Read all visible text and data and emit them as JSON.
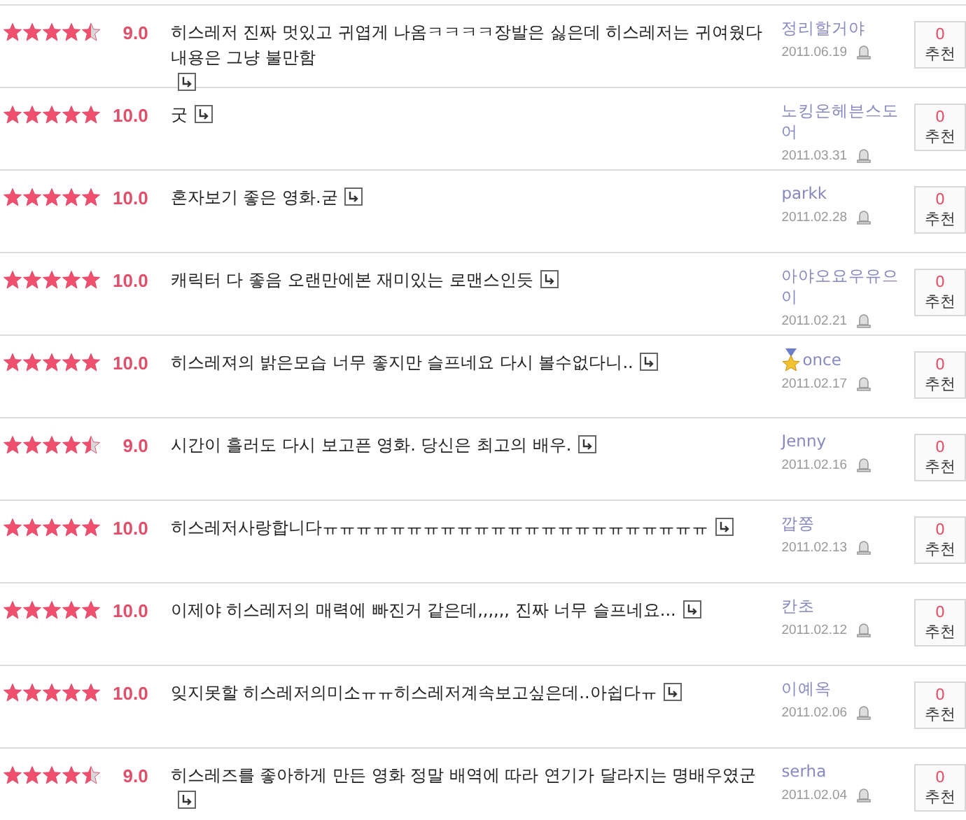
{
  "reviews": [
    {
      "stars": 4.5,
      "score": "9.0",
      "comment": "히스레저 진짜 멋있고 귀엽게 나옴ㅋㅋㅋㅋ장발은 싫은데 히스레저는 귀여웠다 내용은 그냥 불만함",
      "user": "정리할거야",
      "medal": false,
      "date": "2011.06.19",
      "rec_count": "0",
      "rec_label": "추천"
    },
    {
      "stars": 5,
      "score": "10.0",
      "comment": "굿",
      "user": "노킹온헤븐스도어",
      "medal": false,
      "date": "2011.03.31",
      "rec_count": "0",
      "rec_label": "추천"
    },
    {
      "stars": 5,
      "score": "10.0",
      "comment": "혼자보기 좋은 영화.굳",
      "user": "parkk",
      "medal": false,
      "date": "2011.02.28",
      "rec_count": "0",
      "rec_label": "추천"
    },
    {
      "stars": 5,
      "score": "10.0",
      "comment": "캐릭터 다 좋음 오랜만에본 재미있는 로맨스인듯",
      "user": "아야오요우유으이",
      "medal": false,
      "date": "2011.02.21",
      "rec_count": "0",
      "rec_label": "추천"
    },
    {
      "stars": 5,
      "score": "10.0",
      "comment": "히스레져의 밝은모습 너무 좋지만 슬프네요 다시 볼수없다니..",
      "user": "once",
      "medal": true,
      "date": "2011.02.17",
      "rec_count": "0",
      "rec_label": "추천"
    },
    {
      "stars": 4.5,
      "score": "9.0",
      "comment": "시간이 흘러도 다시 보고픈 영화. 당신은 최고의 배우.",
      "user": "Jenny",
      "medal": false,
      "date": "2011.02.16",
      "rec_count": "0",
      "rec_label": "추천"
    },
    {
      "stars": 5,
      "score": "10.0",
      "comment": "히스레저사랑합니다ㅠㅠㅠㅠㅠㅠㅠㅠㅠㅠㅠㅠㅠㅠㅠㅠㅠㅠㅠㅠㅠㅠㅠ",
      "user": "깝쫑",
      "medal": false,
      "date": "2011.02.13",
      "rec_count": "0",
      "rec_label": "추천"
    },
    {
      "stars": 5,
      "score": "10.0",
      "comment": "이제야 히스레저의 매력에 빠진거 같은데,,,,,, 진짜 너무 슬프네요...",
      "user": "칸초",
      "medal": false,
      "date": "2011.02.12",
      "rec_count": "0",
      "rec_label": "추천"
    },
    {
      "stars": 5,
      "score": "10.0",
      "comment": "잊지못할 히스레저의미소ㅠㅠ히스레저계속보고싶은데..아쉽다ㅠ",
      "user": "이예옥",
      "medal": false,
      "date": "2011.02.06",
      "rec_count": "0",
      "rec_label": "추천"
    },
    {
      "stars": 4.5,
      "score": "9.0",
      "comment": "히스레즈를 좋아하게 만든 영화 정말 배역에 따라 연기가 달라지는 명배우였군",
      "user": "serha",
      "medal": false,
      "date": "2011.02.04",
      "rec_count": "0",
      "rec_label": "추천"
    }
  ]
}
